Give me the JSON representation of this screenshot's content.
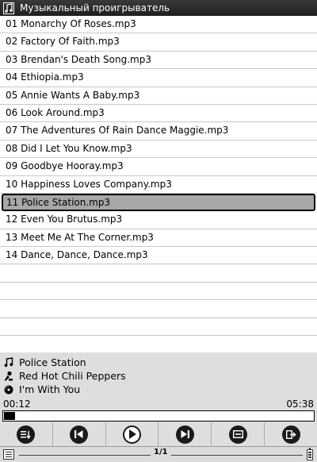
{
  "window": {
    "title": "Музыкальный проигрыватель",
    "icon": "music-note-icon"
  },
  "playlist": {
    "tracks": [
      "01 Monarchy Of Roses.mp3",
      "02 Factory Of Faith.mp3",
      "03 Brendan's Death Song.mp3",
      "04 Ethiopia.mp3",
      "05 Annie Wants A Baby.mp3",
      "06 Look Around.mp3",
      "07 The Adventures Of Rain Dance Maggie.mp3",
      "08 Did I Let You Know.mp3",
      "09 Goodbye Hooray.mp3",
      "10 Happiness Loves Company.mp3",
      "11 Police Station.mp3",
      "12 Even You Brutus.mp3",
      "13 Meet Me At The Corner.mp3",
      "14 Dance, Dance, Dance.mp3"
    ],
    "selected_index": 10
  },
  "now_playing": {
    "title": "Police Station",
    "artist": "Red Hot Chili Peppers",
    "album": "I'm With You",
    "elapsed": "00:12",
    "duration": "05:38",
    "progress_fraction": 0.035
  },
  "controls": [
    {
      "name": "playlist-menu-button",
      "icon": "playlist-icon"
    },
    {
      "name": "previous-track-button",
      "icon": "skip-previous-icon"
    },
    {
      "name": "play-button",
      "icon": "play-icon"
    },
    {
      "name": "next-track-button",
      "icon": "skip-next-icon"
    },
    {
      "name": "minimize-button",
      "icon": "minimize-icon"
    },
    {
      "name": "exit-button",
      "icon": "exit-icon"
    }
  ],
  "status_bar": {
    "page": "1/1",
    "menu_icon": "menu-icon",
    "battery_icon": "battery-icon"
  },
  "colors": {
    "titlebar": "#2b2b2b",
    "selected_row": "#a7a7a7",
    "panel": "#dedede"
  }
}
